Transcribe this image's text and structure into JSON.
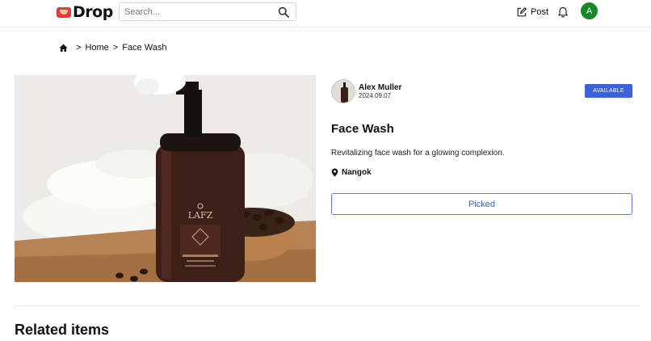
{
  "header": {
    "logo_text": "Drop",
    "search_placeholder": "Search...",
    "post_label": "Post",
    "avatar_initial": "A",
    "icons": {
      "search": "search-icon",
      "post": "pencil-square-icon",
      "notifications": "bell-icon"
    },
    "colors": {
      "logo_mark": "#e23b3b",
      "avatar_bg": "#138a24"
    }
  },
  "breadcrumb": {
    "home_icon": "home-icon",
    "separator": ">",
    "items": [
      "Home",
      "Face Wash"
    ]
  },
  "product": {
    "image_alt": "Face wash foam pump bottle with coffee beans and towel",
    "bottle_brand": "LAFZ",
    "seller": {
      "name": "Alex Muller",
      "date": "2024.09.07"
    },
    "status": "AVAILABLE",
    "title": "Face Wash",
    "description": "Revitalizing face wash for a glowing complexion.",
    "location": "Nangok",
    "action_label": "Picked",
    "colors": {
      "accent": "#3b62d6"
    }
  },
  "related": {
    "heading": "Related items"
  }
}
